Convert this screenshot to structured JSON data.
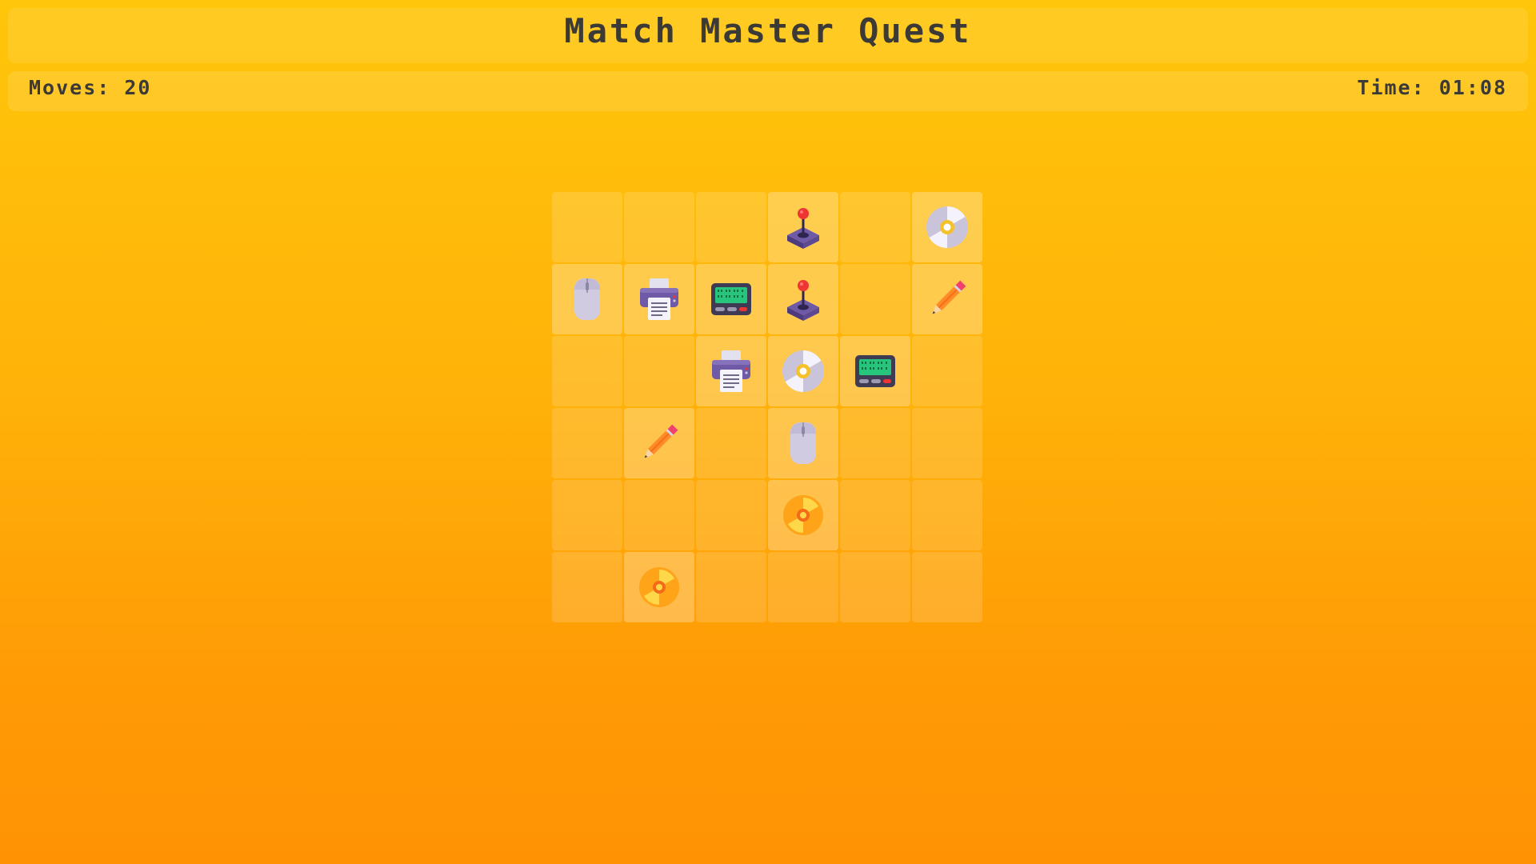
{
  "game": {
    "title": "Match Master Quest",
    "moves_label": "Moves:",
    "moves": "20",
    "time_label": "Time:",
    "time": "01:08"
  },
  "board": {
    "rows": 6,
    "cols": 6,
    "cells": [
      null,
      null,
      null,
      "joystick-icon",
      null,
      "cd-icon",
      "mouse-icon",
      "printer-icon",
      "pager-icon",
      "joystick-icon",
      null,
      "pencil-icon",
      null,
      null,
      "printer-icon",
      "cd-icon",
      "pager-icon",
      null,
      null,
      "pencil-icon",
      null,
      "mouse-icon",
      null,
      null,
      null,
      null,
      null,
      "radiation-icon",
      null,
      null,
      null,
      "radiation-icon",
      null,
      null,
      null,
      null
    ]
  },
  "colors": {
    "background_top": "#ffc60a",
    "background_bottom": "#ff9203",
    "text": "#3c3a36"
  }
}
